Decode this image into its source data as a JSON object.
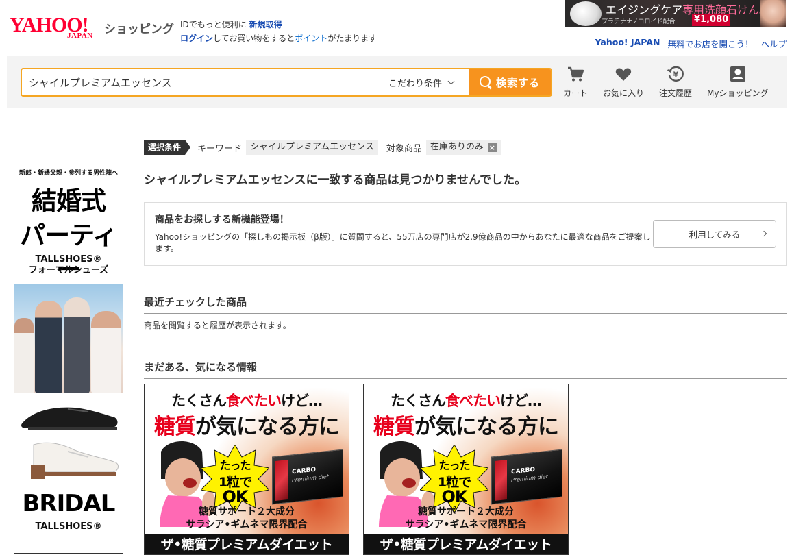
{
  "header": {
    "logo_main": "YAHOO!",
    "logo_sub": "JAPAN",
    "logo_service": "ショッピング",
    "info_line1_prefix": "IDでもっと便利に",
    "info_register": "新規取得",
    "info_login": "ログイン",
    "info_line2_middle": "してお買い物をすると",
    "info_points": "ポイント",
    "info_line2_suffix": "がたまります",
    "top_links": [
      "Yahoo! JAPAN",
      "無料でお店を開こう！",
      "ヘルプ"
    ]
  },
  "top_banner": {
    "headline_a": "エイジングケア",
    "headline_b": "専用洗顔石けん。",
    "sub": "プラチナナノコロイド配合",
    "price": "¥1,080"
  },
  "search": {
    "query": "シャイルプレミアムエッセンス",
    "condition_label": "こだわり条件",
    "button_label": "検索する"
  },
  "nav": [
    {
      "label": "カート",
      "icon": "cart-icon"
    },
    {
      "label": "お気に入り",
      "icon": "heart-icon"
    },
    {
      "label": "注文履歴",
      "icon": "order-history-icon"
    },
    {
      "label": "Myショッピング",
      "icon": "user-icon"
    }
  ],
  "side_banner": {
    "small": "新郎・新婦父親・参列する男性陣へ",
    "big_line1": "結婚式",
    "big_line2": "パーティー",
    "brand_line1": "TALLSHOES®",
    "brand_line2": "フォーマルシューズ",
    "bridal": "BRIDAL",
    "tallshoes": "TALLSHOES®"
  },
  "conditions": {
    "tag": "選択条件",
    "keyword_label": "キーワード",
    "keyword_value": "シャイルプレミアムエッセンス",
    "target_label": "対象商品",
    "target_value": "在庫ありのみ",
    "remove_symbol": "×"
  },
  "no_result_message": "シャイルプレミアムエッセンスに一致する商品は見つかりませんでした。",
  "promo": {
    "title": "商品をお探しする新機能登場！",
    "text": "Yahoo!ショッピングの「探しもの掲示板（β版）」に質問すると、55万店の専門店が2.9億商品の中からあなたに最適な商品をご提案します。",
    "button_label": "利用してみる"
  },
  "recent": {
    "title": "最近チェックした商品",
    "text": "商品を閲覧すると履歴が表示されます。"
  },
  "more_info": {
    "title": "まだある、気になる情報"
  },
  "ads": [
    {
      "l1_a": "たくさん",
      "l1_b": "食べたい",
      "l1_c": "けど…",
      "l2_a": "糖質",
      "l2_b": "が気になる方に",
      "burst_1": "たった",
      "burst_2": "1粒で",
      "burst_3": "OK",
      "box_1": "CARBO",
      "box_2": "Premium diet",
      "l3_1": "糖質サポート２大成分",
      "l3_2": "サラシア•ギムネマ限界配合",
      "footer": "ザ•糖質プレミアムダイエット"
    },
    {
      "l1_a": "たくさん",
      "l1_b": "食べたい",
      "l1_c": "けど…",
      "l2_a": "糖質",
      "l2_b": "が気になる方に",
      "burst_1": "たった",
      "burst_2": "1粒で",
      "burst_3": "OK",
      "box_1": "CARBO",
      "box_2": "Premium diet",
      "l3_1": "糖質サポート２大成分",
      "l3_2": "サラシア•ギムネマ限界配合",
      "footer": "ザ•糖質プレミアムダイエット"
    }
  ],
  "colors": {
    "accent_orange": "#f7931e",
    "yahoo_red": "#ff0033",
    "link_blue": "#1a4db3"
  }
}
